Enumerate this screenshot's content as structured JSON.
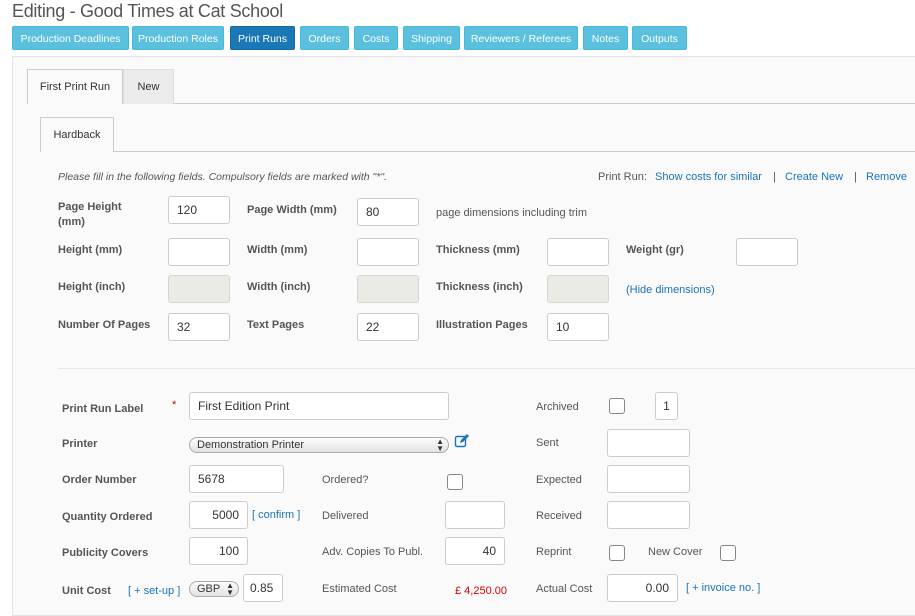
{
  "page": {
    "title": "Editing - Good Times at Cat School"
  },
  "nav": [
    {
      "label": "Production Deadlines"
    },
    {
      "label": "Production Roles"
    },
    {
      "label": "Print Runs"
    },
    {
      "label": "Orders"
    },
    {
      "label": "Costs"
    },
    {
      "label": "Shipping"
    },
    {
      "label": "Reviewers / Referees"
    },
    {
      "label": "Notes"
    },
    {
      "label": "Outputs"
    }
  ],
  "tabs": {
    "first_print_run": "First Print Run",
    "new": "New",
    "hardback": "Hardback"
  },
  "header": {
    "instructions": "Please fill in the following fields. Compulsory fields are marked with \"*\".",
    "print_run_label": "Print Run:",
    "show_costs": "Show costs for similar",
    "sep": "|",
    "create_new": "Create New",
    "remove": "Remove"
  },
  "dims": {
    "page_height_label": "Page Height",
    "page_height_unit": "(mm)",
    "page_height": "120",
    "page_width_label": "Page Width (mm)",
    "page_width": "80",
    "page_dims_note": "page dimensions including trim",
    "height_mm_label": "Height (mm)",
    "width_mm_label": "Width (mm)",
    "thickness_mm_label": "Thickness (mm)",
    "weight_label": "Weight (gr)",
    "height_inch_label": "Height (inch)",
    "width_inch_label": "Width (inch)",
    "thickness_inch_label": "Thickness (inch)",
    "hide_dimensions": "(Hide dimensions)",
    "num_pages_label": "Number Of Pages",
    "num_pages": "32",
    "text_pages_label": "Text Pages",
    "text_pages": "22",
    "illustration_pages_label": "Illustration Pages",
    "illustration_pages": "10"
  },
  "form": {
    "print_run_label_label": "Print Run Label",
    "required_mark": "*",
    "print_run_label": "First Edition Print",
    "archived_label": "Archived",
    "archived_count": "1",
    "printer_label": "Printer",
    "printer": "Demonstration Printer",
    "sent_label": "Sent",
    "order_number_label": "Order Number",
    "order_number": "5678",
    "ordered_label": "Ordered?",
    "expected_label": "Expected",
    "quantity_ordered_label": "Quantity Ordered",
    "quantity_ordered": "5000",
    "confirm": "[ confirm ]",
    "delivered_label": "Delivered",
    "received_label": "Received",
    "publicity_covers_label": "Publicity Covers",
    "publicity_covers": "100",
    "adv_copies_label": "Adv. Copies To Publ.",
    "adv_copies": "40",
    "reprint_label": "Reprint",
    "new_cover_label": "New Cover",
    "unit_cost_label": "Unit Cost",
    "set_up": "[ + set-up ]",
    "currency": "GBP",
    "unit_cost": "0.85",
    "estimated_cost_label": "Estimated Cost",
    "estimated_cost": "£ 4,250.00",
    "actual_cost_label": "Actual Cost",
    "actual_cost": "0.00",
    "invoice_no": "[ + invoice no. ]"
  }
}
